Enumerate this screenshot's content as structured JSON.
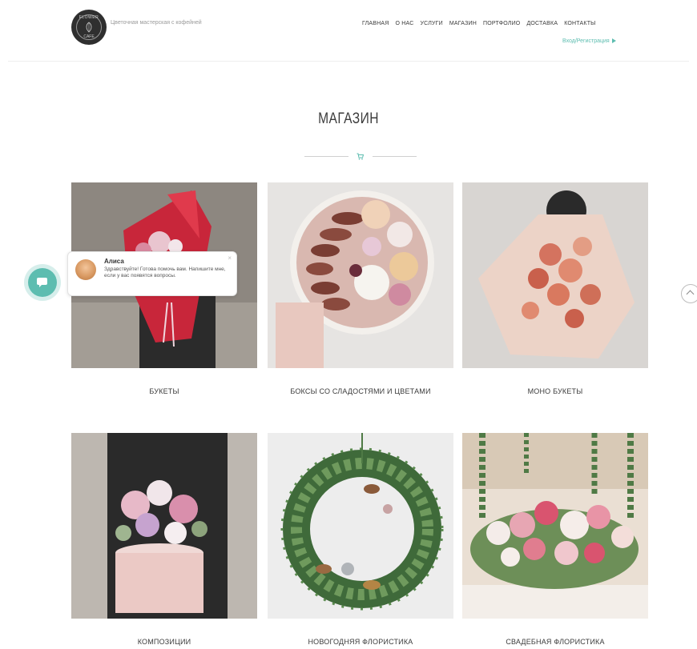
{
  "header": {
    "logo_text_top": "FLOWER",
    "logo_text_bottom": "CAFE",
    "tagline": "Цветочная мастерская с кофейней",
    "nav": [
      "ГЛАВНАЯ",
      "О НАС",
      "УСЛУГИ",
      "МАГАЗИН",
      "ПОРТФОЛИО",
      "ДОСТАВКА",
      "КОНТАКТЫ"
    ],
    "register": "Вход/Регистрация"
  },
  "main": {
    "title": "МАГАЗИН",
    "divider_icon": "cart-icon",
    "categories": [
      {
        "label": "БУКЕТЫ",
        "image": "bouquet-red-photo"
      },
      {
        "label": "БОКСЫ СО СЛАДОСТЯМИ И ЦВЕТАМИ",
        "image": "box-macarons-flowers-photo"
      },
      {
        "label": "МОНО БУКЕТЫ",
        "image": "mono-bouquet-photo"
      },
      {
        "label": "КОМПОЗИЦИИ",
        "image": "composition-hatbox-photo"
      },
      {
        "label": "НОВОГОДНЯЯ ФЛОРИСТИКА",
        "image": "christmas-wreath-photo"
      },
      {
        "label": "СВАДЕБНАЯ ФЛОРИСТИКА",
        "image": "wedding-floristry-photo"
      }
    ]
  },
  "chat": {
    "name": "Алиса",
    "message": "Здравствуйте! Готова помочь вам. Напишите мне, если у вас появятся вопросы.",
    "close": "×",
    "button_icon": "chat-icon"
  },
  "colors": {
    "accent": "#5dbdb0",
    "text": "#3b3b3b"
  }
}
